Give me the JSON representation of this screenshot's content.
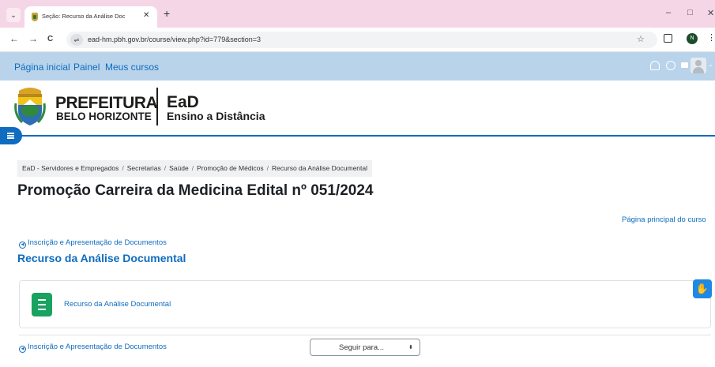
{
  "browser": {
    "tab_title": "Seção: Recurso da Análise Doc",
    "url": "ead-hm.pbh.gov.br/course/view.php?id=779&section=3",
    "profile_initial": "N",
    "menu_glyph": "⌄",
    "close_glyph": "✕",
    "new_tab_glyph": "+",
    "back_glyph": "←",
    "forward_glyph": "→",
    "reload_glyph": "C",
    "site_info_glyph": "⇌",
    "star_glyph": "☆",
    "more_glyph": "⋮",
    "minimize_glyph": "–",
    "maximize_glyph": "□",
    "window_close_glyph": "✕"
  },
  "navbar": {
    "links": [
      "Página inicial",
      "Painel",
      "Meus cursos"
    ],
    "chevron_glyph": "⌄"
  },
  "header": {
    "org_line1": "PREFEITURA",
    "org_line2": "BELO HORIZONTE",
    "ead_line1": "EaD",
    "ead_line2": "Ensino a Distância"
  },
  "breadcrumb": [
    "EaD - Servidores e Empregados",
    "Secretarias",
    "Saúde",
    "Promoção de Médicos",
    "Recurso da Análise Documental"
  ],
  "breadcrumb_sep": "/",
  "page_title": "Promoção Carreira da Medicina Edital nº 051/2024",
  "course_main_link": "Página principal do curso",
  "prev_section_link": "Inscrição e Apresentação de Documentos",
  "section_title": "Recurso da Análise Documental",
  "activity": {
    "name": "Recurso da Análise Documental",
    "icon": "list-icon"
  },
  "next_section_link": "Inscrição e Apresentação de Documentos",
  "jump_select": {
    "label": "Seguir para...",
    "arrow_glyph": "⬍"
  },
  "circle_arrow_glyph": "◀",
  "accessibility_glyph": "✋",
  "colors": {
    "accent": "#0f6cbf",
    "navbar_bg": "#b9d3ea",
    "tabstrip_bg": "#f4d6e6",
    "activity_icon": "#1aa260"
  }
}
